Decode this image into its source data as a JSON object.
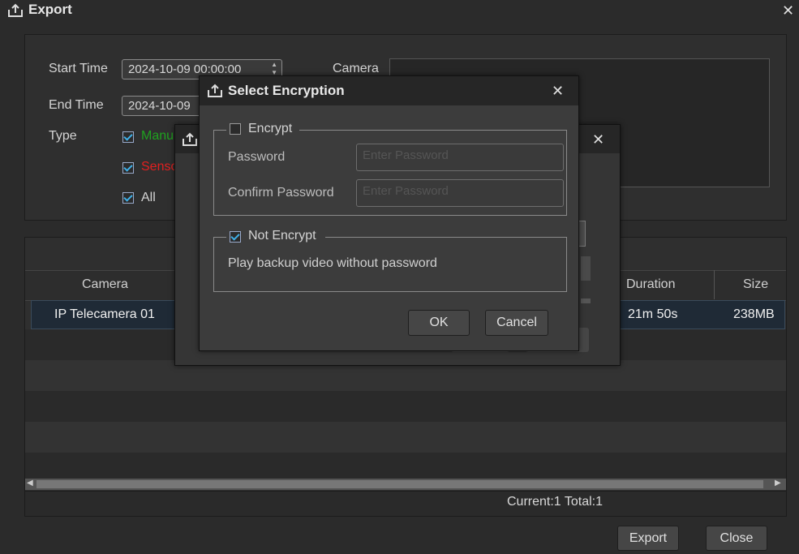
{
  "window": {
    "title": "Export",
    "close_icon": "close-icon"
  },
  "filters": {
    "start_time_label": "Start Time",
    "start_time_value": "2024-10-09 00:00:00",
    "end_time_label": "End Time",
    "end_time_value": "2024-10-09",
    "type_label": "Type",
    "type_options": [
      {
        "label": "Manu",
        "checked": true,
        "color": "#1fa21f"
      },
      {
        "label": "Senso",
        "checked": true,
        "color": "#e02020"
      },
      {
        "label": "All",
        "checked": true,
        "color": "#d4d4d4"
      }
    ],
    "camera_label": "Camera"
  },
  "table": {
    "columns": [
      "Camera",
      "Duration",
      "Size"
    ],
    "rows": [
      {
        "camera": "IP Telecamera 01",
        "duration": "21m 50s",
        "size": "238MB"
      }
    ],
    "pagination": "Current:1 Total:1"
  },
  "footer": {
    "export_label": "Export",
    "close_label": "Close"
  },
  "encryption_dialog": {
    "title": "Select Encryption",
    "encrypt_label": "Encrypt",
    "encrypt_checked": false,
    "password_label": "Password",
    "password_placeholder": "Enter Password",
    "confirm_label": "Confirm Password",
    "confirm_placeholder": "Enter Password",
    "not_encrypt_label": "Not Encrypt",
    "not_encrypt_checked": true,
    "not_encrypt_desc": "Play backup video without password",
    "ok_label": "OK",
    "cancel_label": "Cancel"
  },
  "colors": {
    "accent": "#3fb0e8",
    "background": "#2b2b2b",
    "dialog": "#3c3c3c"
  }
}
